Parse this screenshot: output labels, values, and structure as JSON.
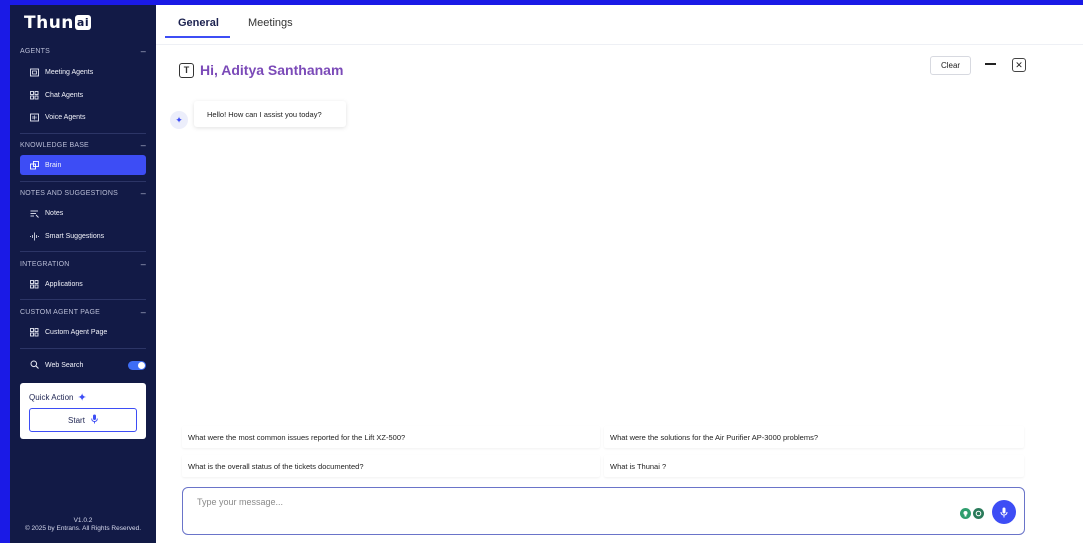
{
  "brand": {
    "logo_text": "Thun",
    "logo_ai": "ai"
  },
  "sidebar": {
    "sections": [
      {
        "title": "AGENTS",
        "collapse": "–"
      },
      {
        "title": "KNOWLEDGE BASE",
        "collapse": "–"
      },
      {
        "title": "NOTES AND SUGGESTIONS",
        "collapse": "–"
      },
      {
        "title": "INTEGRATION",
        "collapse": "–"
      },
      {
        "title": "CUSTOM AGENT PAGE",
        "collapse": "–"
      }
    ],
    "items": [
      {
        "label": "Meeting Agents",
        "icon": "meeting-icon"
      },
      {
        "label": "Chat Agents",
        "icon": "chat-grid-icon"
      },
      {
        "label": "Voice Agents",
        "icon": "voice-icon"
      },
      {
        "label": "Brain",
        "icon": "brain-icon",
        "active": true
      },
      {
        "label": "Notes",
        "icon": "notes-icon"
      },
      {
        "label": "Smart Suggestions",
        "icon": "suggestions-icon"
      },
      {
        "label": "Applications",
        "icon": "apps-icon"
      },
      {
        "label": "Custom Agent Page",
        "icon": "custom-agent-icon"
      }
    ],
    "web_search": {
      "label": "Web Search",
      "enabled": true
    },
    "quick_action": {
      "title": "Quick Action",
      "start_label": "Start"
    },
    "version": "V1.0.2",
    "copyright": "© 2025 by Entrans. All Rights Reserved."
  },
  "tabs": [
    {
      "label": "General",
      "active": true
    },
    {
      "label": "Meetings",
      "active": false
    }
  ],
  "chat": {
    "greeting": "Hi, Aditya Santhanam",
    "clear_label": "Clear",
    "bot_message": "Hello! How can I assist you today?",
    "suggestions": [
      "What were the most common issues reported for the Lift XZ-500?",
      "What were the solutions for the Air Purifier AP-3000 problems?",
      "What is the overall status of the tickets documented?",
      "What is Thunai ?"
    ],
    "input_placeholder": "Type your message..."
  },
  "colors": {
    "sidebar_bg": "#121a46",
    "accent": "#3d4df5",
    "greeting": "#7b4ab8"
  }
}
